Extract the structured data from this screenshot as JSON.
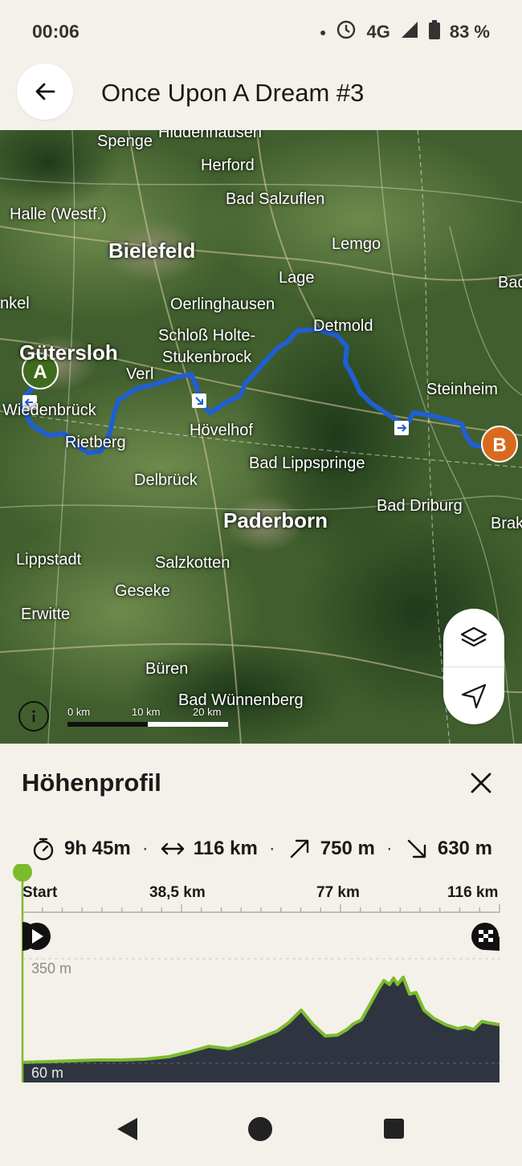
{
  "status_bar": {
    "time": "00:06",
    "network": "4G",
    "battery": "83 %"
  },
  "header": {
    "title": "Once Upon A Dream #3"
  },
  "map": {
    "places": [
      {
        "name": "Spenge",
        "major": false
      },
      {
        "name": "Hiddenhausen",
        "major": false
      },
      {
        "name": "Herford",
        "major": false
      },
      {
        "name": "Bad Salzuflen",
        "major": false
      },
      {
        "name": "Halle (Westf.)",
        "major": false
      },
      {
        "name": "Bielefeld",
        "major": true
      },
      {
        "name": "Lemgo",
        "major": false
      },
      {
        "name": "Lage",
        "major": false
      },
      {
        "name": "Bad",
        "major": false
      },
      {
        "name": "nkel",
        "major": false
      },
      {
        "name": "Oerlinghausen",
        "major": false
      },
      {
        "name": "Detmold",
        "major": false
      },
      {
        "name": "Schloß Holte-",
        "major": false
      },
      {
        "name": "Stukenbrock",
        "major": false
      },
      {
        "name": "Gütersloh",
        "major": true
      },
      {
        "name": "Verl",
        "major": false
      },
      {
        "name": "Steinheim",
        "major": false
      },
      {
        "name": "Wiedenbrück",
        "major": false
      },
      {
        "name": "Hövelhof",
        "major": false
      },
      {
        "name": "Rietberg",
        "major": false
      },
      {
        "name": "Bad Lippspringe",
        "major": false
      },
      {
        "name": "Delbrück",
        "major": false
      },
      {
        "name": "Bad Driburg",
        "major": false
      },
      {
        "name": "Paderborn",
        "major": true
      },
      {
        "name": "Brak",
        "major": false
      },
      {
        "name": "Lippstadt",
        "major": false
      },
      {
        "name": "Salzkotten",
        "major": false
      },
      {
        "name": "Geseke",
        "major": false
      },
      {
        "name": "Erwitte",
        "major": false
      },
      {
        "name": "Büren",
        "major": false
      },
      {
        "name": "Bad Wünnenberg",
        "major": false
      }
    ],
    "start_marker": "A",
    "end_marker": "B",
    "scale": {
      "l0": "0 km",
      "l1": "10 km",
      "l2": "20 km"
    },
    "route_color": "#1f5fd1",
    "start_color": "#3f6b1f",
    "end_color": "#d86a1e"
  },
  "profile": {
    "title": "Höhenprofil",
    "duration": "9h 45m",
    "distance": "116 km",
    "ascent": "750 m",
    "descent": "630 m",
    "separator": "·",
    "axis": [
      "Start",
      "38,5 km",
      "77 km",
      "116 km"
    ],
    "elev_max": "350 m",
    "elev_min": "60 m",
    "line_color": "#7cbb2e",
    "fill_color": "#2e3540"
  }
}
